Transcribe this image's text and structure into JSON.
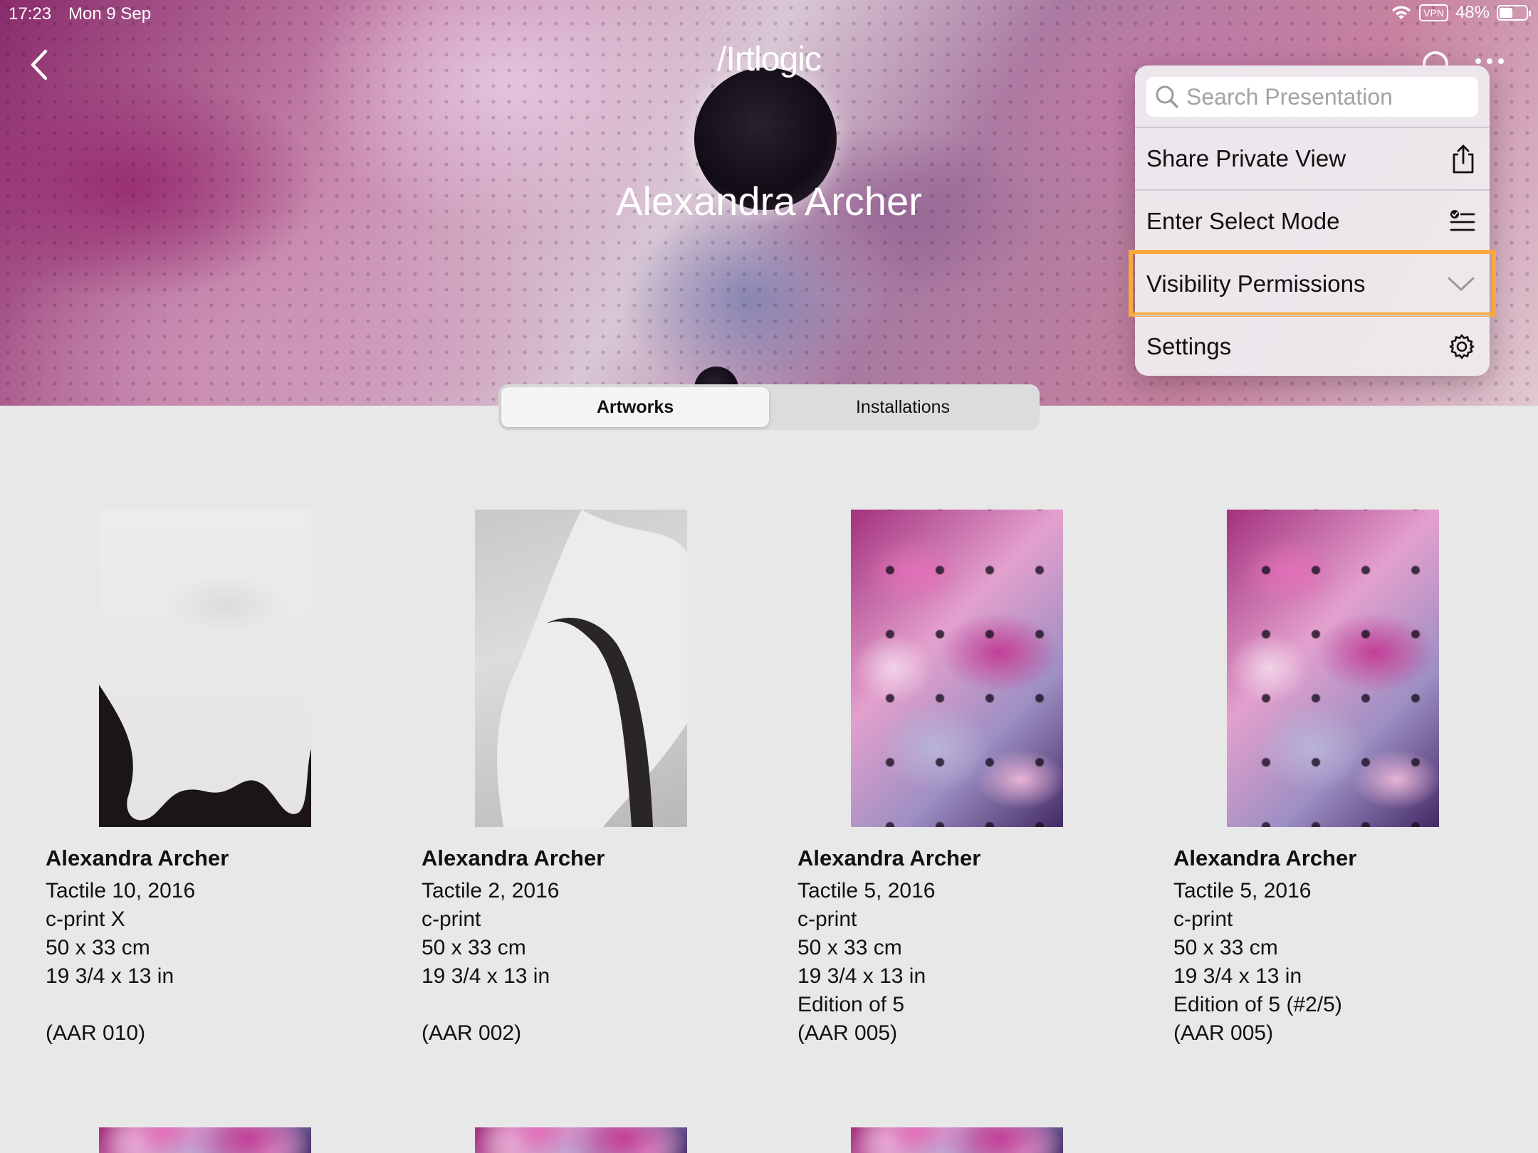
{
  "status_bar": {
    "time": "17:23",
    "date": "Mon 9 Sep",
    "vpn": "VPN",
    "battery": "48%"
  },
  "header": {
    "logo": "/Irtlogic",
    "title": "Alexandra Archer"
  },
  "tabs": [
    {
      "label": "Artworks",
      "selected": true
    },
    {
      "label": "Installations",
      "selected": false
    }
  ],
  "menu": {
    "search_placeholder": "Search Presentation",
    "items": [
      {
        "label": "Share Private View",
        "icon": "share-icon"
      },
      {
        "label": "Enter Select Mode",
        "icon": "select-list-icon"
      },
      {
        "label": "Visibility Permissions",
        "icon": "chevron-down-icon",
        "highlighted": true
      },
      {
        "label": "Settings",
        "icon": "gear-icon"
      }
    ],
    "highlight_color": "#f7a93a"
  },
  "artworks": [
    {
      "artist": "Alexandra Archer",
      "title": "Tactile 10, 2016",
      "medium": "c-print X",
      "size_cm": "50 x 33 cm",
      "size_in": "19 3/4 x 13 in",
      "edition": "",
      "ref": "(AAR 010)"
    },
    {
      "artist": "Alexandra Archer",
      "title": "Tactile 2, 2016",
      "medium": "c-print",
      "size_cm": "50 x 33 cm",
      "size_in": "19 3/4 x 13 in",
      "edition": "",
      "ref": "(AAR 002)"
    },
    {
      "artist": "Alexandra Archer",
      "title": "Tactile 5, 2016",
      "medium": "c-print",
      "size_cm": "50 x 33 cm",
      "size_in": "19 3/4 x 13 in",
      "edition": "Edition of 5",
      "ref": "(AAR 005)"
    },
    {
      "artist": "Alexandra Archer",
      "title": "Tactile 5, 2016",
      "medium": "c-print",
      "size_cm": "50 x 33 cm",
      "size_in": "19 3/4 x 13 in",
      "edition": "Edition of 5 (#2/5)",
      "ref": "(AAR 005)"
    }
  ]
}
